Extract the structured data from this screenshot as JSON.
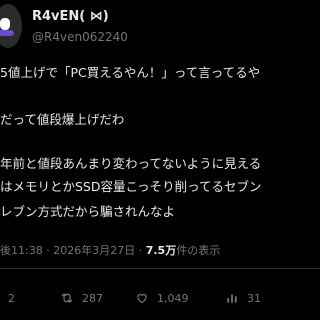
{
  "author": {
    "name": "R4vEN( ⋈)",
    "handle": "@R4ven062240"
  },
  "post": {
    "lines": [
      "5値上げで「PC買えるやん！」って言ってるや",
      "だって値段爆上げだわ",
      "年前と値段あんまり変わってないように見える",
      "はメモリとかSSD容量こっそり削ってるセブン",
      "レブン方式だから騙されんなよ"
    ]
  },
  "meta": {
    "time": "後11:38",
    "dot1": "·",
    "date": "2026年3月27日",
    "dot2": "·",
    "views_count": "7.5万",
    "views_label": "件の表示"
  },
  "actions": {
    "replies": "2",
    "reposts": "287",
    "likes": "1,049",
    "views": "31"
  },
  "colors": {
    "background": "#000000",
    "text": "#e7e9ea",
    "muted": "#71767b",
    "divider": "#2f3336"
  }
}
